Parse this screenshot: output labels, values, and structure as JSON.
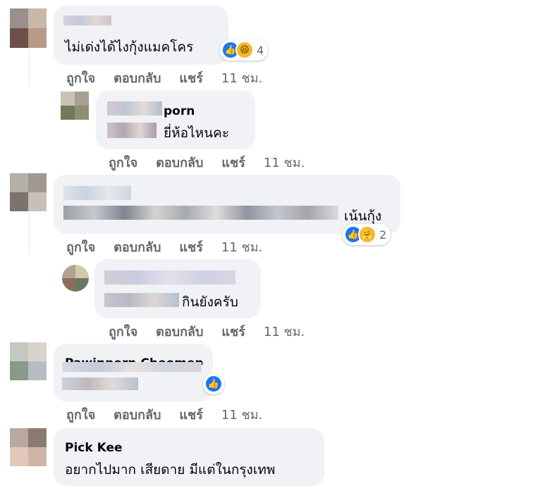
{
  "comments": [
    {
      "text": "ไม่เด่งได้ไงกุ้งแมคโคร",
      "reaction_count": "4"
    },
    {
      "name_visible": "porn",
      "text": "ยี่ห้อไหนคะ"
    },
    {
      "text": "เน้นกุ้ง",
      "reaction_count": "2"
    },
    {
      "text": "กินยังครับ"
    },
    {
      "name_visible": "Pawinporn Choomen"
    },
    {
      "name": "Pick Kee",
      "text": "อยากไปมาก เสียดาย มีแต่ในกรุงเทพ"
    }
  ],
  "actions": {
    "like": "ถูกใจ",
    "reply": "ตอบกลับ",
    "share": "แชร์"
  },
  "timestamps": [
    "11 ชม.",
    "11 ชม.",
    "11 ชม.",
    "11 ชม.",
    "11 ชม."
  ],
  "colors": {
    "like_blue": "#1877f2",
    "bubble_bg": "#f0f2f5",
    "meta_gray": "#65676b"
  },
  "icons": [
    "like-icon",
    "haha-icon",
    "care-icon"
  ]
}
